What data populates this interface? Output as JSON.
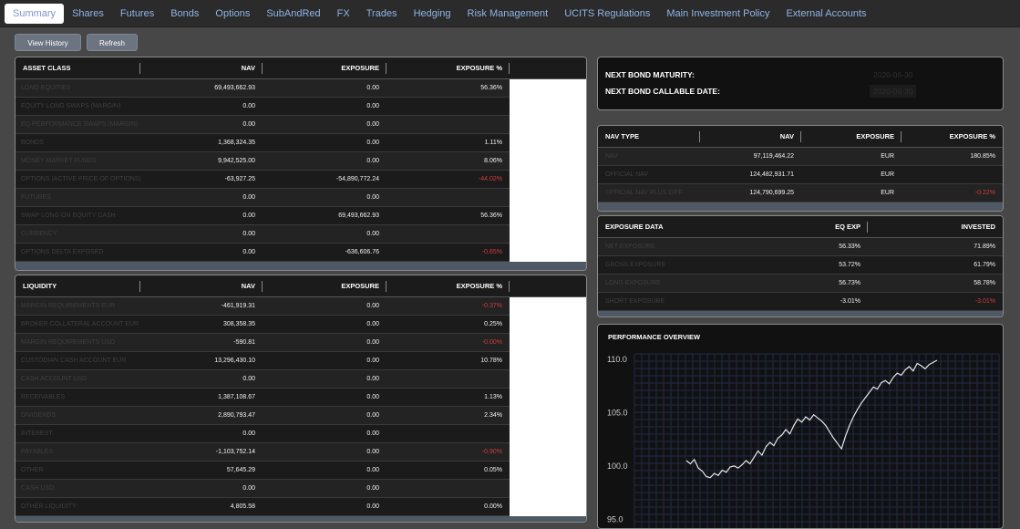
{
  "tabs": [
    "Summary",
    "Shares",
    "Futures",
    "Bonds",
    "Options",
    "SubAndRed",
    "FX",
    "Trades",
    "Hedging",
    "Risk Management",
    "UCITS Regulations",
    "Main Investment Policy",
    "External Accounts"
  ],
  "buttons": {
    "view_history": "View History",
    "refresh": "Refresh"
  },
  "asset_class": {
    "headers": {
      "name": "ASSET CLASS",
      "nav": "NAV",
      "exposure": "EXPOSURE",
      "exposure_pct": "EXPOSURE %"
    },
    "rows": [
      {
        "name": "LONG EQUITIES",
        "nav": "69,493,662.93",
        "exposure": "0.00",
        "pct": "56.36%",
        "neg": false
      },
      {
        "name": "EQUITY LONG SWAPS (MARGIN)",
        "nav": "0.00",
        "exposure": "0.00",
        "pct": "",
        "neg": false
      },
      {
        "name": "EQ PERFORMANCE SWAPS (MARGIN)",
        "nav": "0.00",
        "exposure": "0.00",
        "pct": "",
        "neg": false
      },
      {
        "name": "BONDS",
        "nav": "1,368,324.35",
        "exposure": "0.00",
        "pct": "1.11%",
        "neg": false
      },
      {
        "name": "MONEY MARKET FUNDS",
        "nav": "9,942,525.00",
        "exposure": "0.00",
        "pct": "8.06%",
        "neg": false
      },
      {
        "name": "OPTIONS (ACTIVE PRICE OF OPTIONS)",
        "nav": "-63,927.25",
        "exposure": "-54,890,772.24",
        "pct": "-44.02%",
        "neg": true
      },
      {
        "name": "FUTURES",
        "nav": "0.00",
        "exposure": "0.00",
        "pct": "",
        "neg": false
      },
      {
        "name": "SWAP LONG ON EQUITY CASH",
        "nav": "0.00",
        "exposure": "69,493,662.93",
        "pct": "56.36%",
        "neg": false
      },
      {
        "name": "CURRENCY",
        "nav": "0.00",
        "exposure": "0.00",
        "pct": "",
        "neg": false
      },
      {
        "name": "OPTIONS DELTA EXPOSED",
        "nav": "0.00",
        "exposure": "-636,606.76",
        "pct": "-0.65%",
        "neg": true
      }
    ]
  },
  "liquidity": {
    "headers": {
      "name": "LIQUIDITY",
      "nav": "NAV",
      "exposure": "EXPOSURE",
      "exposure_pct": "EXPOSURE %"
    },
    "rows": [
      {
        "name": "MARGIN REQUIREMENTS EUR",
        "nav": "-461,919.31",
        "exposure": "0.00",
        "pct": "-0.37%",
        "neg": true
      },
      {
        "name": "BROKER COLLATERAL ACCOUNT EUR",
        "nav": "308,358.35",
        "exposure": "0.00",
        "pct": "0.25%",
        "neg": false
      },
      {
        "name": "MARGIN REQUIREMENTS USD",
        "nav": "-590.81",
        "exposure": "0.00",
        "pct": "-0.00%",
        "neg": true
      },
      {
        "name": "CUSTODIAN CASH ACCOUNT EUR",
        "nav": "13,296,430.10",
        "exposure": "0.00",
        "pct": "10.78%",
        "neg": false
      },
      {
        "name": "CASH ACCOUNT USD",
        "nav": "0.00",
        "exposure": "0.00",
        "pct": "",
        "neg": false
      },
      {
        "name": "RECEIVABLES",
        "nav": "1,387,108.67",
        "exposure": "0.00",
        "pct": "1.13%",
        "neg": false
      },
      {
        "name": "DIVIDENDS",
        "nav": "2,890,793.47",
        "exposure": "0.00",
        "pct": "2.34%",
        "neg": false
      },
      {
        "name": "INTEREST",
        "nav": "0.00",
        "exposure": "0.00",
        "pct": "",
        "neg": false
      },
      {
        "name": "PAYABLES",
        "nav": "-1,103,752.14",
        "exposure": "0.00",
        "pct": "-0.90%",
        "neg": true
      },
      {
        "name": "OTHER",
        "nav": "57,645.29",
        "exposure": "0.00",
        "pct": "0.05%",
        "neg": false
      },
      {
        "name": "CASH USD",
        "nav": "0.00",
        "exposure": "0.00",
        "pct": "",
        "neg": false
      },
      {
        "name": "OTHER LIQUIDITY",
        "nav": "4,805.58",
        "exposure": "0.00",
        "pct": "0.00%",
        "neg": false
      }
    ]
  },
  "bond_info": {
    "maturity_label": "NEXT BOND MATURITY:",
    "maturity_value": "2020-06-30",
    "callable_label": "NEXT BOND CALLABLE DATE:",
    "callable_value": "2020-06-30"
  },
  "nav_type": {
    "headers": {
      "type": "NAV TYPE",
      "nav": "NAV",
      "exposure": "EXPOSURE",
      "exposure_pct": "EXPOSURE %"
    },
    "rows": [
      {
        "type": "NAV",
        "nav": "97,119,464.22",
        "exposure": "EUR",
        "pct": "180.85%",
        "neg": false
      },
      {
        "type": "OFFICIAL NAV",
        "nav": "124,482,931.71",
        "exposure": "EUR",
        "pct": "",
        "neg": false
      },
      {
        "type": "OFFICIAL NAV PLUS DIFF",
        "nav": "124,790,699.25",
        "exposure": "EUR",
        "pct": "-0.22%",
        "neg": true
      }
    ]
  },
  "exposure_data": {
    "headers": {
      "name": "EXPOSURE DATA",
      "eq_exp": "EQ EXP",
      "invested": "INVESTED"
    },
    "rows": [
      {
        "name": "NET EXPOSURE",
        "eq_exp": "56.33%",
        "invested": "71.89%",
        "neg": false
      },
      {
        "name": "GROSS EXPOSURE",
        "eq_exp": "53.72%",
        "invested": "61.79%",
        "neg": false
      },
      {
        "name": "LONG EXPOSURE",
        "eq_exp": "56.73%",
        "invested": "58.78%",
        "neg": false
      },
      {
        "name": "SHORT EXPOSURE",
        "eq_exp": "-3.01%",
        "invested": "-3.01%",
        "neg": true
      }
    ]
  },
  "chart_data": {
    "type": "line",
    "title": "PERFORMANCE OVERVIEW",
    "yticks": [
      "110.0",
      "105.0",
      "100.0",
      "95.0"
    ],
    "ylim": [
      94,
      110.5
    ],
    "series": [
      {
        "values": [
          100.5,
          100.2,
          100.6,
          99.8,
          99.5,
          99.0,
          98.9,
          99.3,
          99.1,
          99.6,
          99.4,
          99.9,
          100.0,
          99.8,
          100.1,
          100.5,
          100.2,
          100.8,
          101.4,
          101.0,
          101.8,
          102.2,
          101.9,
          102.6,
          102.9,
          103.4,
          103.0,
          103.8,
          104.4,
          104.1,
          104.6,
          104.3,
          104.8,
          104.5,
          104.2,
          103.8,
          103.2,
          102.6,
          102.1,
          101.6,
          102.8,
          103.8,
          104.6,
          105.3,
          105.9,
          106.4,
          106.9,
          107.4,
          107.2,
          107.8,
          108.0,
          107.7,
          108.3,
          108.7,
          108.5,
          109.0,
          109.3,
          108.9,
          109.6,
          109.4,
          109.1,
          109.5,
          109.7,
          109.9
        ]
      }
    ],
    "line_color": "#e6e6e6"
  }
}
